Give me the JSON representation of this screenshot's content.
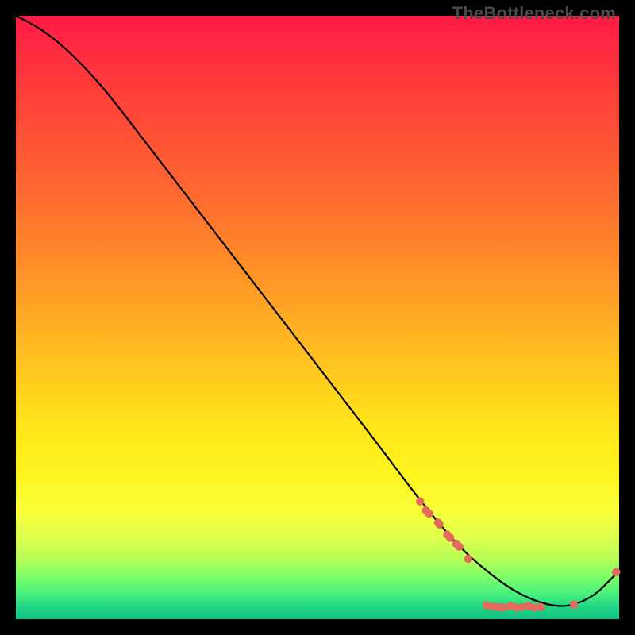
{
  "watermark": "TheBottleneck.com",
  "colors": {
    "background": "#000000",
    "line": "#000000",
    "dot": "#e46a5e",
    "watermark": "#4a4a4a"
  },
  "chart_data": {
    "type": "line",
    "title": "",
    "xlabel": "",
    "ylabel": "",
    "xlim": [
      0,
      100
    ],
    "ylim": [
      0,
      100
    ],
    "grid": false,
    "legend": false,
    "series": [
      {
        "name": "curve",
        "x": [
          0,
          3,
          6,
          10,
          15,
          20,
          30,
          40,
          50,
          60,
          66,
          70,
          74,
          78,
          82,
          86,
          90,
          93,
          96,
          98,
          100
        ],
        "y": [
          100,
          98.5,
          96.5,
          93,
          87.5,
          81,
          68,
          55,
          42,
          29,
          21,
          16,
          11.5,
          8,
          5,
          3,
          2,
          2.5,
          4,
          6,
          8
        ]
      }
    ],
    "dots": [
      {
        "x": 67.0,
        "y": 19.5
      },
      {
        "x": 68.0,
        "y": 18.0
      },
      {
        "x": 68.5,
        "y": 17.5
      },
      {
        "x": 70.0,
        "y": 16.0
      },
      {
        "x": 70.2,
        "y": 15.7
      },
      {
        "x": 71.5,
        "y": 14.0
      },
      {
        "x": 72.0,
        "y": 13.5
      },
      {
        "x": 73.0,
        "y": 12.5
      },
      {
        "x": 73.5,
        "y": 12.0
      },
      {
        "x": 75.0,
        "y": 10.0
      },
      {
        "x": 78.0,
        "y": 2.3
      },
      {
        "x": 79.0,
        "y": 2.1
      },
      {
        "x": 80.0,
        "y": 2.0
      },
      {
        "x": 80.8,
        "y": 1.9
      },
      {
        "x": 82.0,
        "y": 2.2
      },
      {
        "x": 83.0,
        "y": 1.9
      },
      {
        "x": 84.0,
        "y": 2.0
      },
      {
        "x": 85.0,
        "y": 2.2
      },
      {
        "x": 86.0,
        "y": 1.9
      },
      {
        "x": 87.0,
        "y": 2.0
      },
      {
        "x": 92.5,
        "y": 2.4
      },
      {
        "x": 99.5,
        "y": 7.8
      }
    ]
  }
}
